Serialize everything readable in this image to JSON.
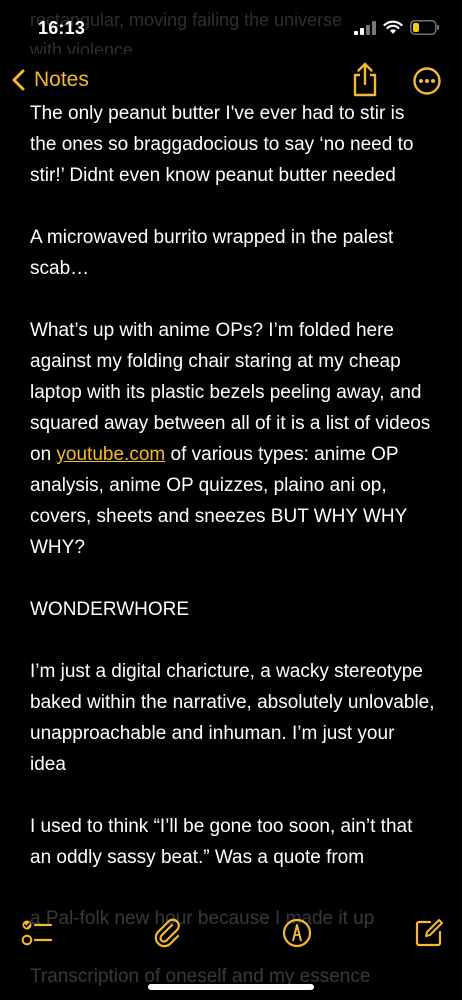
{
  "status_bar": {
    "time": "16:13"
  },
  "nav": {
    "back_label": "Notes",
    "accent_color": "#f5b82e"
  },
  "ghost_top": {
    "line1": "rectangular, moving failing the universe",
    "line2": "with violence"
  },
  "note": {
    "p1": "The only peanut butter I've ever had to stir is the ones so braggadocious to say ‘no need to stir!’ Didnt even know peanut butter needed",
    "p2": "A microwaved burrito wrapped in the palest scab…",
    "p3_before": "What’s up with anime OPs? I’m folded here against my folding chair staring at my cheap laptop with its plastic bezels peeling away, and squared away between all of it is a list of videos on ",
    "p3_link": "youtube.com",
    "p3_after": " of various types: anime OP analysis, anime OP quizzes, plaino ani op, covers, sheets and sneezes BUT WHY WHY WHY?",
    "p4": "WONDERWHORE",
    "p5": "I’m just a digital charicture, a wacky stereotype baked within the narrative, absolutely unlovable, unapproachable and inhuman. I’m just your idea",
    "p6": "I used to think “I’ll be gone too soon, ain’t that an oddly sassy beat.” Was a quote from"
  },
  "toolbar_ghost": {
    "line1": "a Pal-folk new hour because I made it up",
    "line2": "Transcription of oneself and my essence"
  },
  "icons": {
    "back": "chevron-left-icon",
    "share": "share-icon",
    "more": "ellipsis-circle-icon",
    "checklist": "checklist-icon",
    "attach": "paperclip-icon",
    "markup": "markup-pen-icon",
    "compose": "compose-icon"
  }
}
